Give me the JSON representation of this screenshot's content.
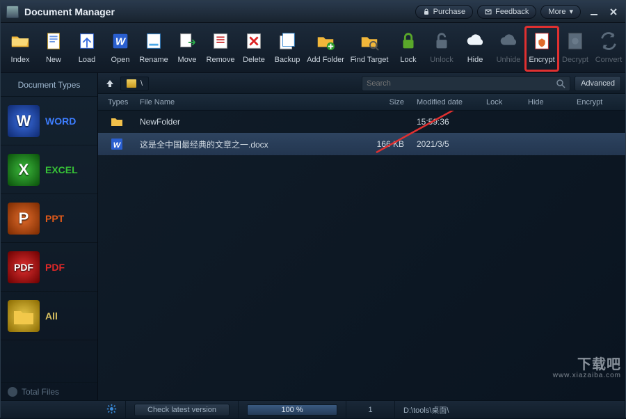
{
  "app": {
    "title": "Document Manager"
  },
  "titlebar": {
    "purchase": "Purchase",
    "feedback": "Feedback",
    "more": "More"
  },
  "toolbar": {
    "index": "Index",
    "new": "New",
    "load": "Load",
    "open": "Open",
    "rename": "Rename",
    "move": "Move",
    "remove": "Remove",
    "delete": "Delete",
    "backup": "Backup",
    "addfolder": "Add Folder",
    "findtarget": "Find Target",
    "lock": "Lock",
    "unlock": "Unlock",
    "hide": "Hide",
    "unhide": "Unhide",
    "encrypt": "Encrypt",
    "decrypt": "Decrypt",
    "convert": "Convert"
  },
  "sidebar": {
    "header": "Document Types",
    "word": "WORD",
    "excel": "EXCEL",
    "ppt": "PPT",
    "pdf": "PDF",
    "all": "All",
    "total": "Total Files"
  },
  "pathbar": {
    "path": "\\"
  },
  "search": {
    "placeholder": "Search",
    "advanced": "Advanced"
  },
  "columns": {
    "types": "Types",
    "name": "File Name",
    "size": "Size",
    "date": "Modified date",
    "lock": "Lock",
    "hide": "Hide",
    "encrypt": "Encrypt"
  },
  "rows": [
    {
      "kind": "folder",
      "name": "NewFolder",
      "size": "",
      "date": "15:59:36"
    },
    {
      "kind": "docx",
      "name": "这是全中国最经典的文章之一.docx",
      "size": "166 KB",
      "date": "2021/3/5"
    }
  ],
  "status": {
    "check": "Check latest version",
    "progress_pct": 100,
    "progress_label": "100 %",
    "count": "1",
    "path": "D:\\tools\\桌面\\"
  },
  "watermark": {
    "brand": "下载吧",
    "url": "www.xiazaiba.com"
  }
}
